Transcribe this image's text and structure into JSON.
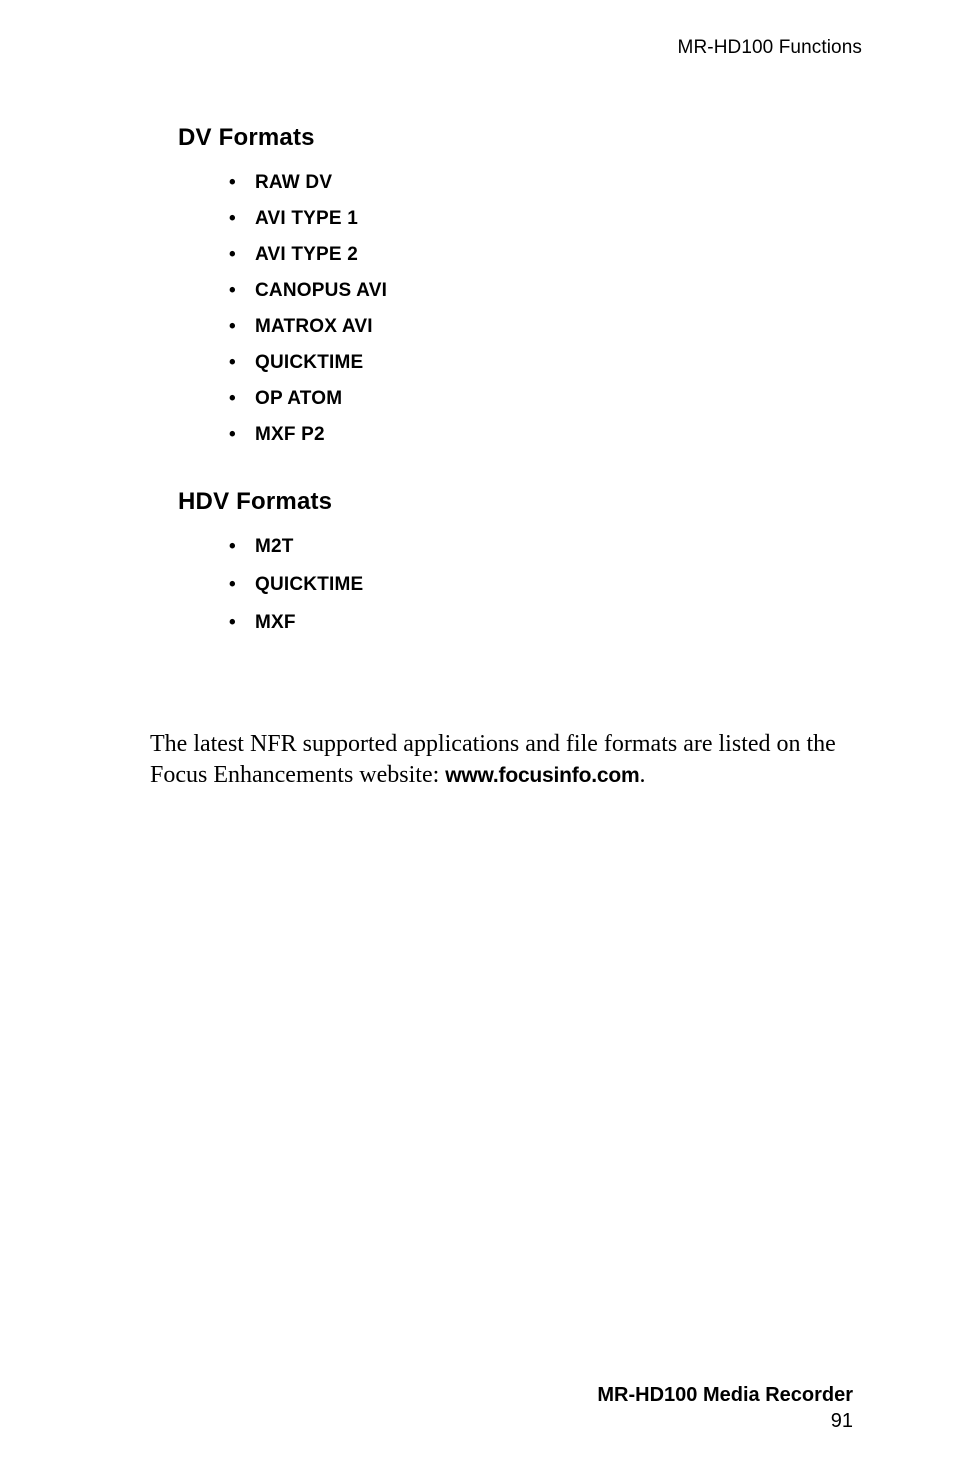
{
  "header": {
    "title": "MR-HD100 Functions"
  },
  "sections": [
    {
      "heading": "DV Formats",
      "bullet_glyph": "•",
      "items": [
        "RAW DV",
        "AVI TYPE 1",
        "AVI TYPE 2",
        "CANOPUS AVI",
        "MATROX AVI",
        "QUICKTIME",
        "OP ATOM",
        "MXF P2"
      ]
    },
    {
      "heading": "HDV Formats",
      "bullet_glyph": "•",
      "items": [
        "M2T",
        "QUICKTIME",
        "MXF"
      ]
    }
  ],
  "paragraph": {
    "part1": "The latest NFR supported applications and file formats are listed on the Focus Enhancements website: ",
    "url": "www.focusinfo.com",
    "part2": "."
  },
  "footer": {
    "product": "MR-HD100 Media Recorder",
    "page_number": "91"
  },
  "colors": {
    "page_background": "#ffffff",
    "text": "#000000"
  }
}
